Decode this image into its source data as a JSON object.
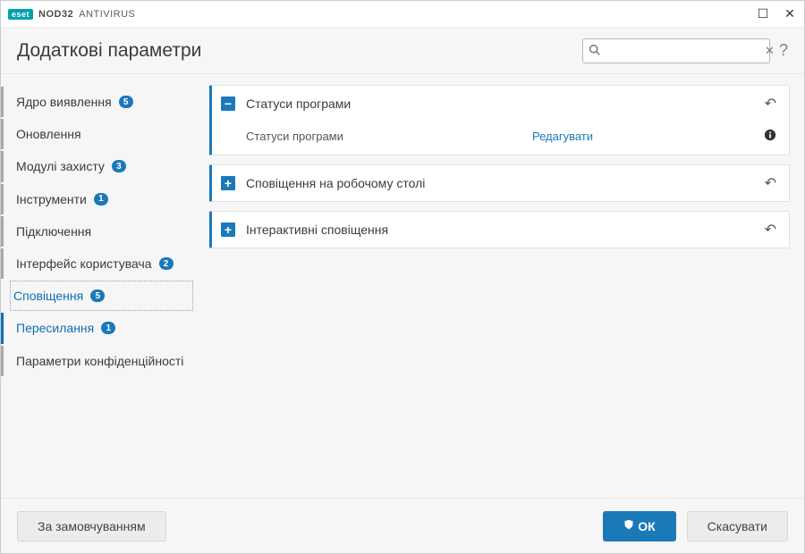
{
  "titlebar": {
    "logo": "eset",
    "product_bold": "NOD32",
    "product_light": "ANTIVIRUS"
  },
  "header": {
    "title": "Додаткові параметри",
    "search_placeholder": ""
  },
  "sidebar": [
    {
      "key": "detection-core",
      "label": "Ядро виявлення",
      "badge": "5",
      "top": true
    },
    {
      "key": "update",
      "label": "Оновлення",
      "badge": null,
      "top": true
    },
    {
      "key": "protection",
      "label": "Модулі захисту",
      "badge": "3",
      "top": true
    },
    {
      "key": "tools",
      "label": "Інструменти",
      "badge": "1",
      "top": true
    },
    {
      "key": "connections",
      "label": "Підключення",
      "badge": null,
      "top": true
    },
    {
      "key": "ui",
      "label": "Інтерфейс користувача",
      "badge": "2",
      "top": true
    },
    {
      "key": "notifications",
      "label": "Сповіщення",
      "badge": "5",
      "top": false,
      "selected": true
    },
    {
      "key": "forwarding",
      "label": "Пересилання",
      "badge": "1",
      "top": false,
      "active": true
    },
    {
      "key": "privacy",
      "label": "Параметри конфіденційності",
      "badge": null,
      "top": true
    }
  ],
  "panels": {
    "appstatus": {
      "title": "Статуси програми",
      "row_label": "Статуси програми",
      "row_action": "Редагувати"
    },
    "desktop_notif": {
      "title": "Сповіщення на робочому столі"
    },
    "interactive_notif": {
      "title": "Інтерактивні сповіщення"
    }
  },
  "footer": {
    "defaults": "За замовчуванням",
    "ok": "ОК",
    "cancel": "Скасувати"
  }
}
